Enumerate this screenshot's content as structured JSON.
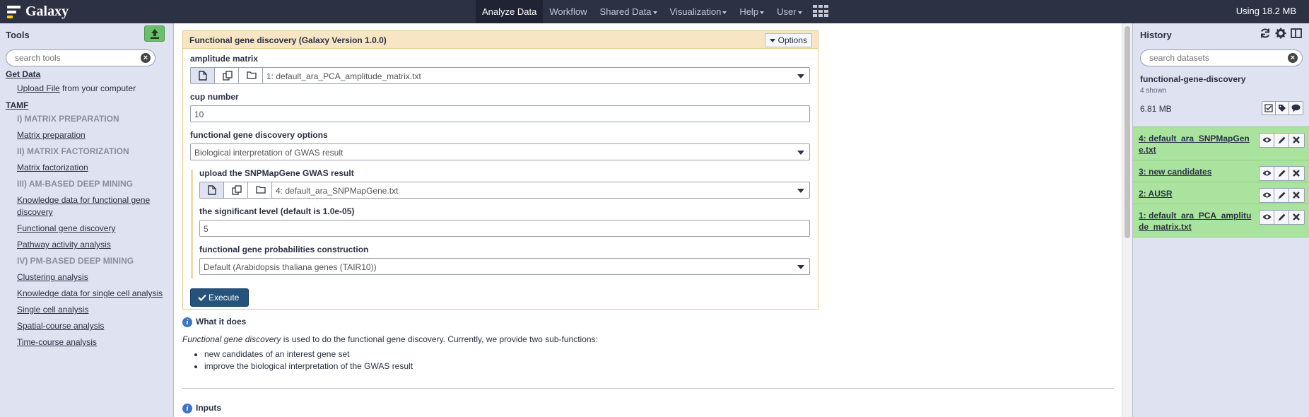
{
  "masthead": {
    "brand": "Galaxy",
    "nav": [
      {
        "label": "Analyze Data",
        "active": true,
        "caret": false
      },
      {
        "label": "Workflow",
        "active": false,
        "caret": false
      },
      {
        "label": "Shared Data",
        "active": false,
        "caret": true
      },
      {
        "label": "Visualization",
        "active": false,
        "caret": true
      },
      {
        "label": "Help",
        "active": false,
        "caret": true
      },
      {
        "label": "User",
        "active": false,
        "caret": true
      }
    ],
    "quota": "Using 18.2 MB"
  },
  "tools": {
    "title": "Tools",
    "search_placeholder": "search tools",
    "get_data": "Get Data",
    "upload_link": "Upload File",
    "upload_suffix": " from your computer",
    "section": "TAMF",
    "items": [
      {
        "type": "label",
        "text": "I) MATRIX PREPARATION"
      },
      {
        "type": "link",
        "text": "Matrix preparation"
      },
      {
        "type": "label",
        "text": "II) MATRIX FACTORIZATION"
      },
      {
        "type": "link",
        "text": "Matrix factorization"
      },
      {
        "type": "label",
        "text": "III) AM-BASED DEEP MINING"
      },
      {
        "type": "link",
        "text": "Knowledge data for functional gene discovery"
      },
      {
        "type": "link",
        "text": "Functional gene discovery"
      },
      {
        "type": "link",
        "text": "Pathway activity analysis"
      },
      {
        "type": "label",
        "text": "IV) PM-BASED DEEP MINING"
      },
      {
        "type": "link",
        "text": "Clustering analysis"
      },
      {
        "type": "link",
        "text": "Knowledge data for single cell analysis"
      },
      {
        "type": "link",
        "text": "Single cell analysis"
      },
      {
        "type": "link",
        "text": "Spatial-course analysis"
      },
      {
        "type": "link",
        "text": "Time-course analysis"
      }
    ]
  },
  "form": {
    "title": "Functional gene discovery (Galaxy Version 1.0.0)",
    "options_label": "Options",
    "amplitude_label": "amplitude matrix",
    "amplitude_value": "1: default_ara_PCA_amplitude_matrix.txt",
    "cup_label": "cup number",
    "cup_value": "10",
    "options_section_label": "functional gene discovery options",
    "options_section_value": "Biological interpretation of GWAS result",
    "snp_label": "upload the SNPMapGene GWAS result",
    "snp_value": "4: default_ara_SNPMapGene.txt",
    "sig_label": "the significant level (default is 1.0e-05)",
    "sig_value": "5",
    "prob_label": "functional gene probabilities construction",
    "prob_value": "Default (Arabidopsis thaliana genes (TAIR10))",
    "execute_label": "Execute"
  },
  "help": {
    "what_title": "What it does",
    "intro_italic": "Functional gene discovery",
    "intro_rest": " is used to do the functional gene discovery. Currently, we provide two sub-functions:",
    "bullets": [
      "new candidates of an interest gene set",
      "improve the biological interpretation of the GWAS result"
    ],
    "inputs_title": "Inputs"
  },
  "history": {
    "title": "History",
    "search_placeholder": "search datasets",
    "name": "functional-gene-discovery",
    "shown": "4 shown",
    "size": "6.81 MB",
    "datasets": [
      {
        "name": "4: default_ara_SNPMapGene.txt"
      },
      {
        "name": "3: new candidates"
      },
      {
        "name": "2: AUSR"
      },
      {
        "name": "1: default_ara_PCA_amplitude_matrix.txt"
      }
    ]
  },
  "colors": {
    "masthead": "#2c3143",
    "panel": "#dee2f1",
    "form_header": "#f7e5c3",
    "dataset_ok": "#aae39e",
    "execute": "#25537b"
  }
}
